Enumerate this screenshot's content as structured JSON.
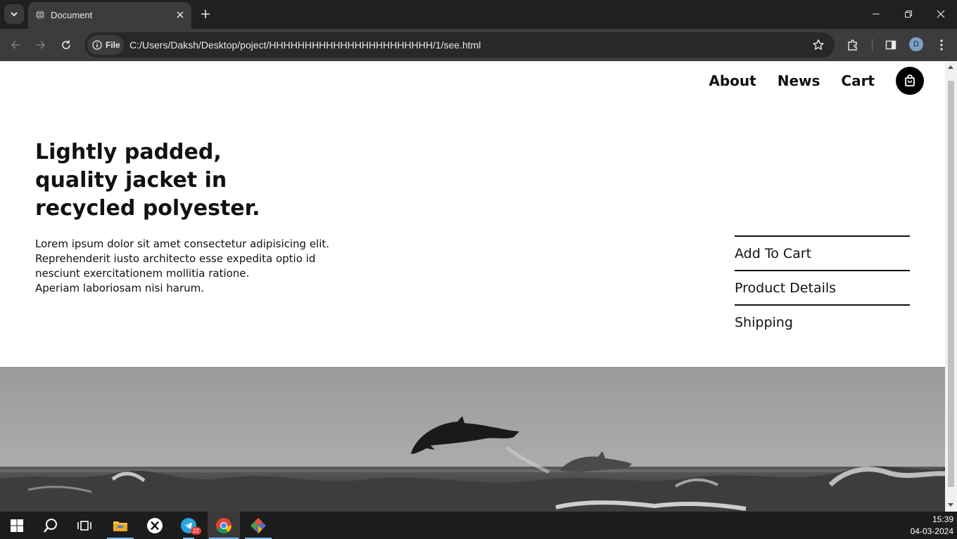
{
  "browser": {
    "tab_title": "Document",
    "site_chip": "File",
    "url": "C:/Users/Daksh/Desktop/poject/HHHHHHHHHHHHHHHHHHHHHHH/1/see.html",
    "profile_initial": "D"
  },
  "site": {
    "nav": [
      "About",
      "News",
      "Cart"
    ],
    "hero": {
      "title_lines": [
        "Lightly padded,",
        "quality jacket in",
        "recycled polyester."
      ],
      "body_lines": [
        "Lorem ipsum dolor sit amet consectetur adipisicing elit.",
        "Reprehenderit iusto architecto esse expedita optio id",
        "nesciunt exercitationem mollitia ratione.",
        "Aperiam laboriosam nisi harum."
      ]
    },
    "side_menu": [
      "Add To Cart",
      "Product Details",
      "Shipping"
    ]
  },
  "taskbar": {
    "telegram_badge": "22",
    "time": "15:39",
    "date": "04-03-2024"
  },
  "colors": {
    "chrome_dark": "#202020",
    "chrome_toolbar": "#3c3c3c",
    "page_bg": "#ffffff",
    "text": "#111111"
  }
}
